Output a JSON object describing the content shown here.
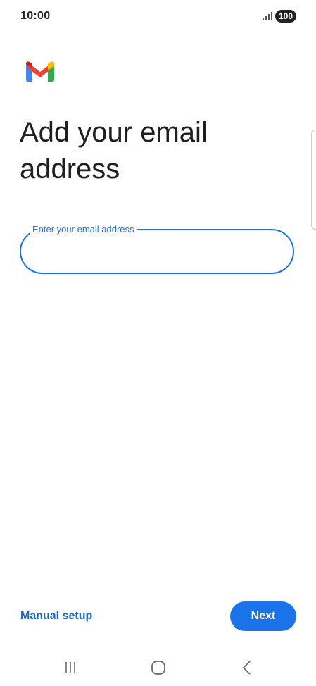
{
  "status_bar": {
    "time": "10:00",
    "signal_icon": "signal-bars-icon",
    "battery": "100"
  },
  "header": {
    "logo_icon": "gmail-logo-icon",
    "title": "Add your email address"
  },
  "email_field": {
    "label": "Enter your email address",
    "value": "",
    "placeholder": ""
  },
  "actions": {
    "manual_setup_label": "Manual setup",
    "next_label": "Next"
  },
  "nav_bar": {
    "recents_icon": "recents-icon",
    "home_icon": "home-icon",
    "back_icon": "back-icon"
  },
  "colors": {
    "accent": "#1a73e8",
    "link": "#1a65c9",
    "text": "#1f1f1f",
    "background": "#ffffff",
    "gmail_blue": "#4285f4",
    "gmail_red": "#ea4335",
    "gmail_yellow": "#fbbc04",
    "gmail_green": "#34a853",
    "gmail_dark_red": "#c5221f"
  }
}
